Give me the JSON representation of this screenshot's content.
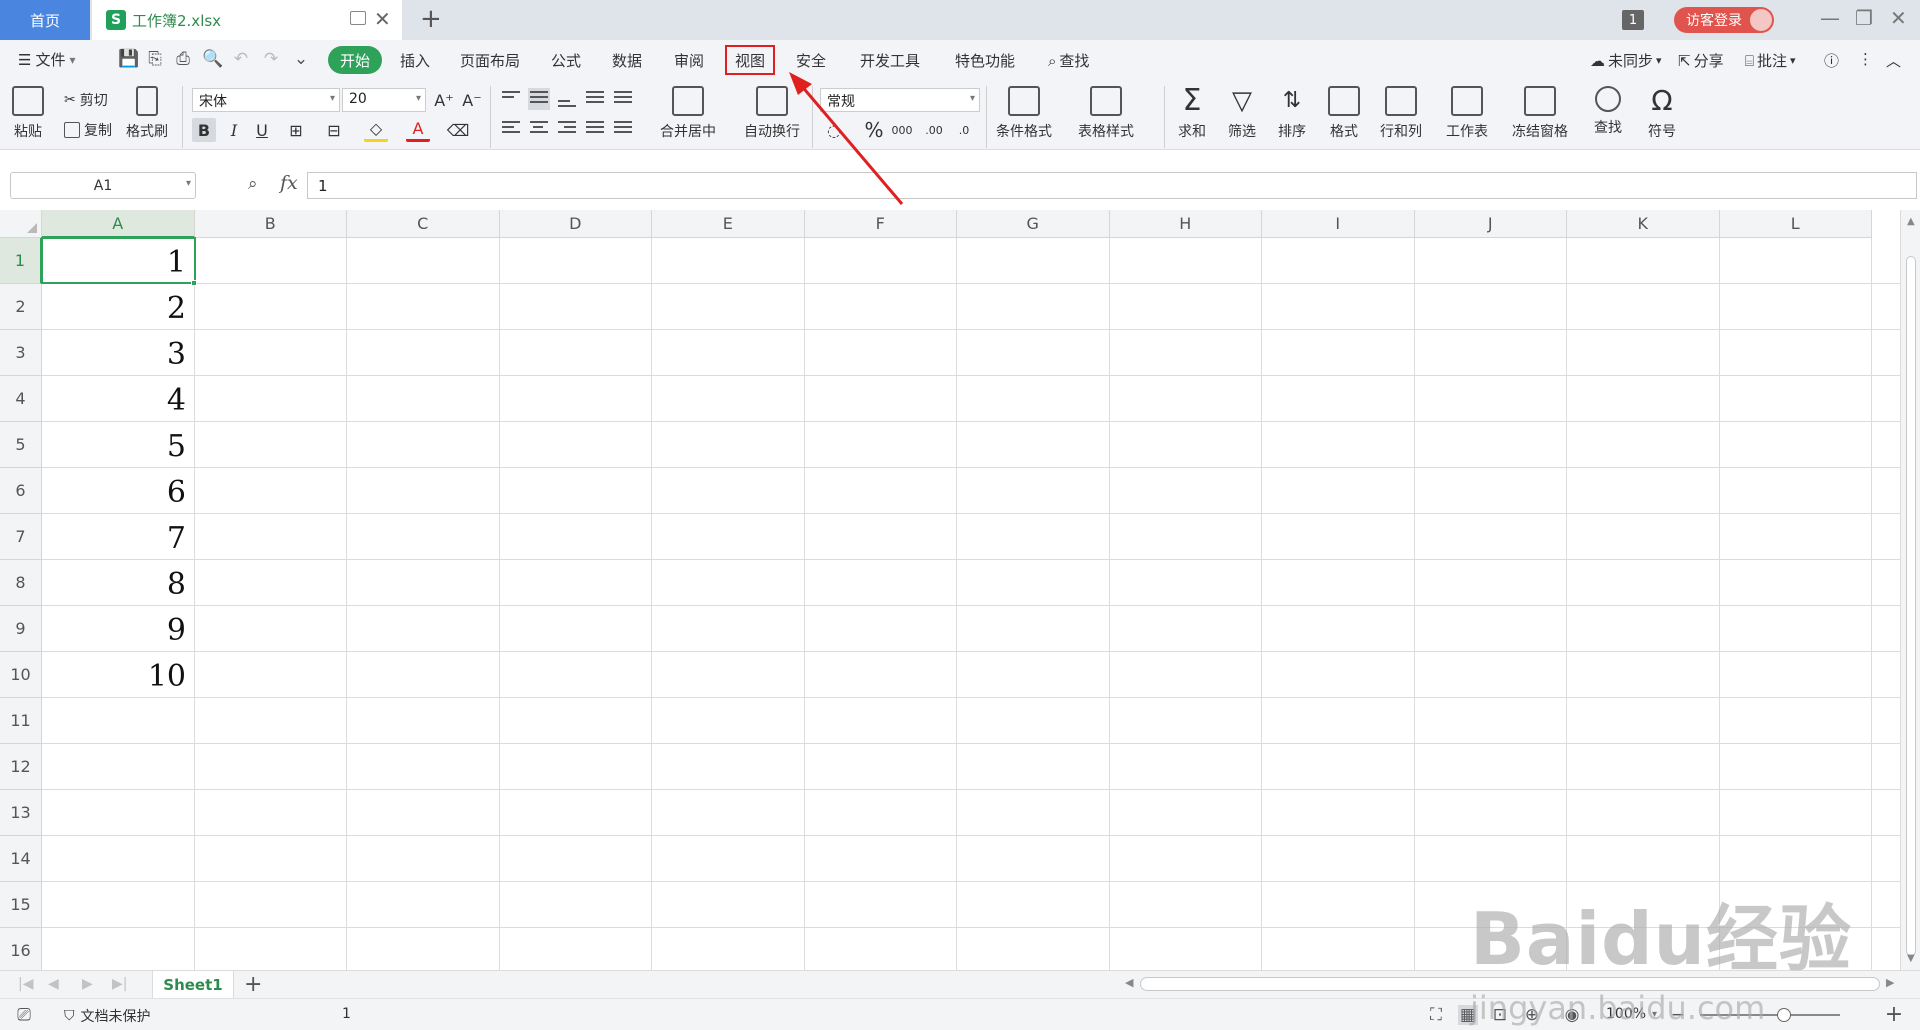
{
  "titlebar": {
    "home_tab": "首页",
    "doc_icon": "S",
    "doc_title": "工作簿2.xlsx",
    "window_count": "1",
    "login_label": "访客登录"
  },
  "menubar": {
    "file_label": "文件",
    "tabs": [
      "开始",
      "插入",
      "页面布局",
      "公式",
      "数据",
      "审阅",
      "视图",
      "安全",
      "开发工具",
      "特色功能",
      "查找"
    ],
    "active_tab": "开始",
    "highlighted_tab": "视图",
    "sync_label": "未同步",
    "share_label": "分享",
    "comment_label": "批注"
  },
  "ribbon": {
    "paste": "粘贴",
    "cut": "剪切",
    "copy": "复制",
    "format_painter": "格式刷",
    "font_name": "宋体",
    "font_size": "20",
    "bold": "B",
    "italic": "I",
    "underline": "U",
    "font_color": "A",
    "merge_center": "合并居中",
    "wrap_text": "自动换行",
    "number_format": "常规",
    "percent": "%",
    "thousands": "000",
    "inc_decimal": ".00",
    "dec_decimal": ".0",
    "conditional_format": "条件格式",
    "table_style": "表格样式",
    "sum": "求和",
    "filter": "筛选",
    "sort": "排序",
    "format": "格式",
    "row_col": "行和列",
    "worksheet": "工作表",
    "freeze": "冻结窗格",
    "find": "查找",
    "symbol": "符号"
  },
  "formula_bar": {
    "name_box": "A1",
    "fx_label": "fx",
    "formula_value": "1"
  },
  "grid": {
    "columns": [
      "A",
      "B",
      "C",
      "D",
      "E",
      "F",
      "G",
      "H",
      "I",
      "J",
      "K",
      "L"
    ],
    "rows": [
      "1",
      "2",
      "3",
      "4",
      "5",
      "6",
      "7",
      "8",
      "9",
      "10",
      "11",
      "12",
      "13",
      "14",
      "15",
      "16"
    ],
    "column_a_values": [
      "1",
      "2",
      "3",
      "4",
      "5",
      "6",
      "7",
      "8",
      "9",
      "10"
    ],
    "selected_cell": "A1"
  },
  "sheets": {
    "tabs": [
      "Sheet1"
    ]
  },
  "statusbar": {
    "protect_label": "文档未保护",
    "cell_summary": "1",
    "zoom": "100%"
  },
  "watermark": {
    "main": "Baidu经验",
    "sub": "jingyan.baidu.com"
  },
  "colors": {
    "accent_green": "#2fa25a",
    "home_tab_blue": "#4a86e0",
    "login_red": "#e1544e",
    "annotation_red": "#e02020"
  }
}
